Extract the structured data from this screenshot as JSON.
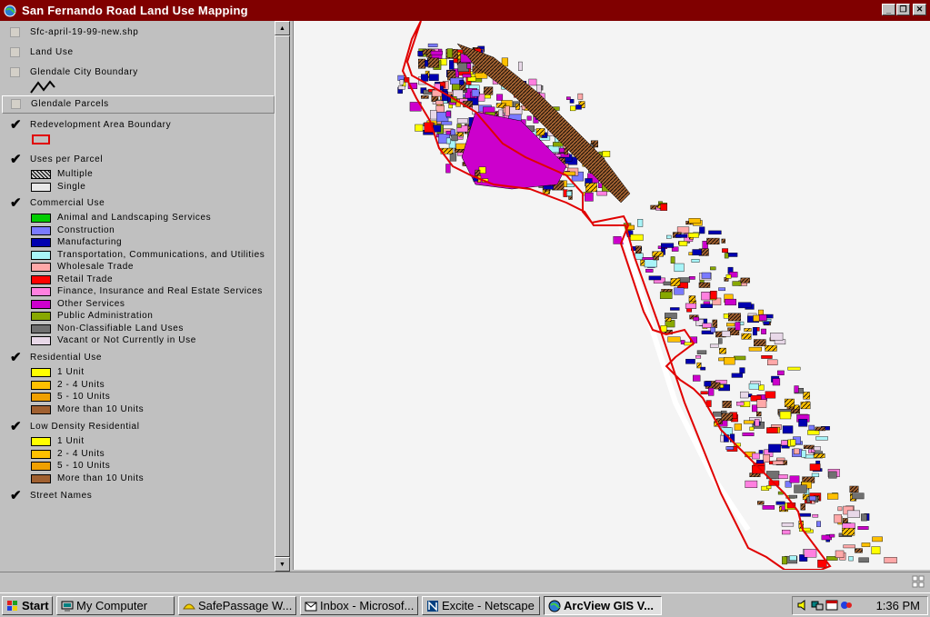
{
  "window": {
    "title": "San Fernando Road Land Use Mapping"
  },
  "toc": {
    "layers": [
      {
        "name": "Sfc-april-19-99-new.shp",
        "checked": false
      },
      {
        "name": "Land Use",
        "checked": false
      },
      {
        "name": "Glendale City Boundary",
        "checked": false
      },
      {
        "name": "Glendale Parcels",
        "checked": false,
        "active": true
      },
      {
        "name": "Redevelopment Area Boundary",
        "checked": true
      },
      {
        "name": "Uses per Parcel",
        "checked": true,
        "legend": [
          {
            "label": "Multiple",
            "color": "#d0d0d0"
          },
          {
            "label": "Single",
            "color": "#e8e8e8"
          }
        ]
      },
      {
        "name": "Commercial Use",
        "checked": true,
        "legend": [
          {
            "label": "Animal and Landscaping Services",
            "color": "#00cc00"
          },
          {
            "label": "Construction",
            "color": "#7a7aff"
          },
          {
            "label": "Manufacturing",
            "color": "#0000b0"
          },
          {
            "label": "Transportation, Communications, and Utilities",
            "color": "#a8f4f8"
          },
          {
            "label": "Wholesale Trade",
            "color": "#ffa8a8"
          },
          {
            "label": "Retail Trade",
            "color": "#ff0000"
          },
          {
            "label": "Finance, Insurance and Real Estate Services",
            "color": "#ff80e0"
          },
          {
            "label": "Other Services",
            "color": "#cc00cc"
          },
          {
            "label": "Public Administration",
            "color": "#88a800"
          },
          {
            "label": "Non-Classifiable Land Uses",
            "color": "#707070"
          },
          {
            "label": "Vacant or Not Currently in Use",
            "color": "#e8d8e8"
          }
        ]
      },
      {
        "name": "Residential Use",
        "checked": true,
        "legend": [
          {
            "label": "1 Unit",
            "color": "#ffff00"
          },
          {
            "label": "2 - 4 Units",
            "color": "#ffc000"
          },
          {
            "label": "5 - 10 Units",
            "color": "#f0a000"
          },
          {
            "label": "More than 10 Units",
            "color": "#a06030"
          }
        ]
      },
      {
        "name": "Low Density Residential",
        "checked": true,
        "legend": [
          {
            "label": "1 Unit",
            "color": "#ffff00"
          },
          {
            "label": "2 - 4 Units",
            "color": "#ffc000"
          },
          {
            "label": "5 - 10 Units",
            "color": "#f0a000"
          },
          {
            "label": "More than 10 Units",
            "color": "#a06030"
          }
        ]
      },
      {
        "name": "Street Names",
        "checked": true
      }
    ]
  },
  "taskbar": {
    "start": "Start",
    "buttons": [
      {
        "label": "My Computer"
      },
      {
        "label": "SafePassage W..."
      },
      {
        "label": "Inbox - Microsof..."
      },
      {
        "label": "Excite - Netscape"
      },
      {
        "label": "ArcView GIS V...",
        "active": true
      }
    ],
    "clock": "1:36 PM"
  }
}
